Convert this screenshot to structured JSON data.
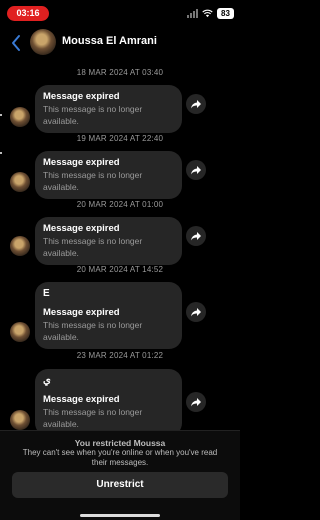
{
  "status": {
    "time": "03:16",
    "battery": "83"
  },
  "header": {
    "contact_name": "Moussa El Amrani",
    "back_icon": "chevron-left-icon",
    "accent": "#3a7bd5"
  },
  "thread": {
    "groups": [
      {
        "timestamp": "18 MAR 2024 AT 03:40",
        "text": "",
        "title": "Message expired",
        "subtitle": "This message is no longer available."
      },
      {
        "timestamp": "19 MAR 2024 AT 22:40",
        "text": "",
        "title": "Message expired",
        "subtitle": "This message is no longer available."
      },
      {
        "timestamp": "20 MAR 2024 AT 01:00",
        "text": "",
        "title": "Message expired",
        "subtitle": "This message is no longer available."
      },
      {
        "timestamp": "20 MAR 2024 AT 14:52",
        "text": "E",
        "title": "Message expired",
        "subtitle": "This message is no longer available."
      },
      {
        "timestamp": "23 MAR 2024 AT 01:22",
        "text": "ي",
        "title": "Message expired",
        "subtitle": "This message is no longer available."
      }
    ]
  },
  "footer": {
    "restricted_title": "You restricted Moussa",
    "restricted_desc": "They can't see when you're online or when you've read their messages.",
    "unrestrict_label": "Unrestrict"
  },
  "icons": {
    "share": "share-arrow-icon",
    "wifi": "wifi-icon",
    "signal": "signal-icon",
    "battery": "battery-icon"
  }
}
